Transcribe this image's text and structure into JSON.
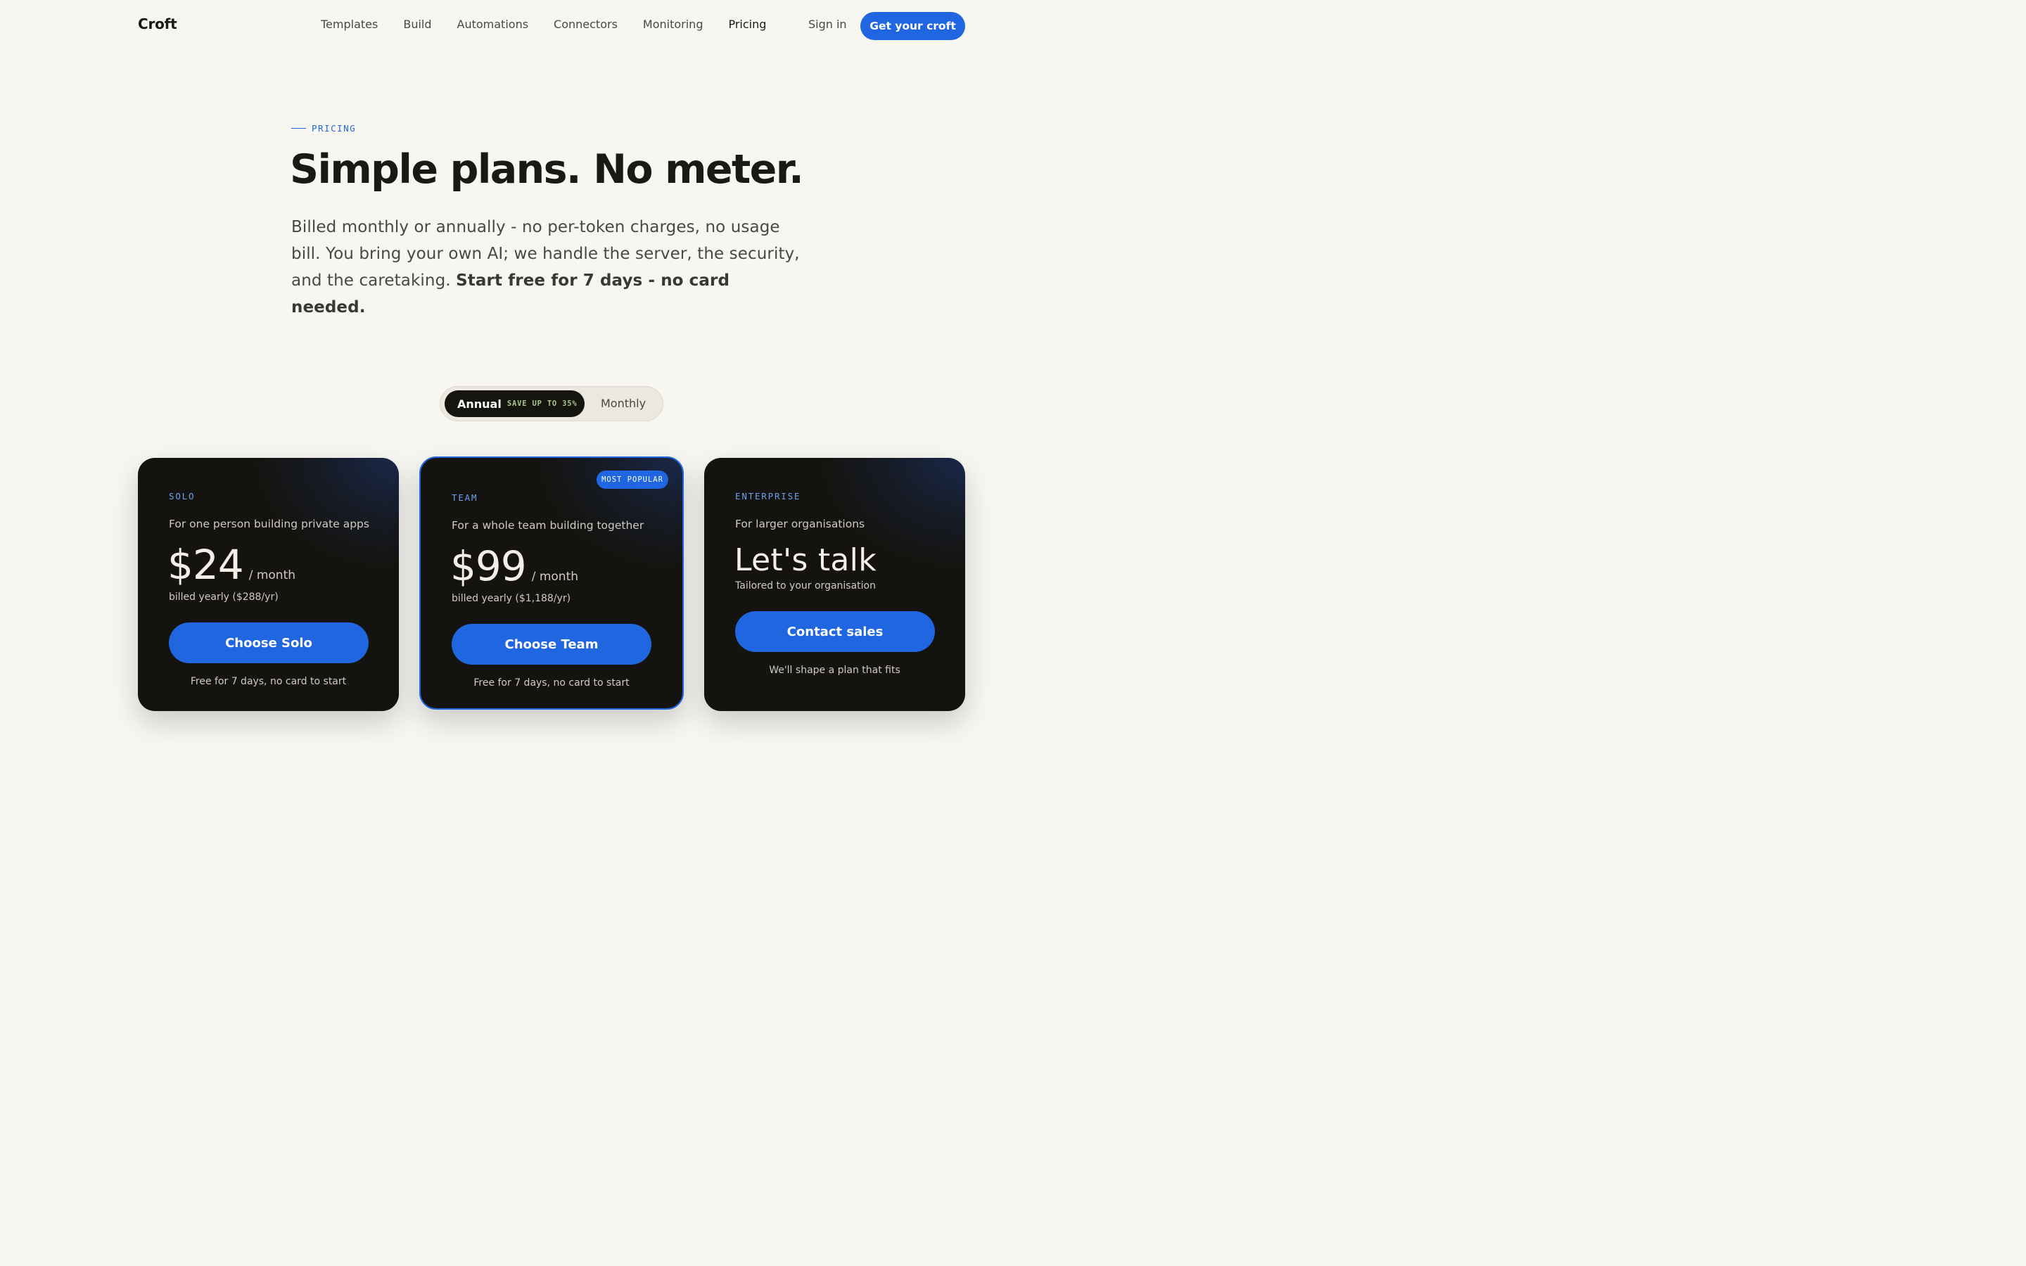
{
  "nav": {
    "logo": "Croft",
    "links": [
      "Templates",
      "Build",
      "Automations",
      "Connectors",
      "Monitoring",
      "Pricing"
    ],
    "active": "Pricing",
    "signin": "Sign in",
    "cta": "Get your croft"
  },
  "hero": {
    "eyebrow": "PRICING",
    "headline": "Simple plans. No meter.",
    "lede": "Billed monthly or annually - no per-token charges, no usage bill. You bring your own AI; we handle the server, the security, and the caretaking.",
    "lede_strong": "Start free for 7 days - no card needed."
  },
  "toggle": {
    "annual": "Annual",
    "save": "SAVE UP TO 35%",
    "monthly": "Monthly",
    "selected": "Annual"
  },
  "plans": [
    {
      "tier": "SOLO",
      "desc": "For one person building private apps",
      "price": "$24",
      "per": "/ month",
      "billed": "billed yearly ($288/yr)",
      "button": "Choose Solo",
      "note": "Free for 7 days, no card to start"
    },
    {
      "tier": "TEAM",
      "badge": "MOST POPULAR",
      "desc": "For a whole team building together",
      "price": "$99",
      "per": "/ month",
      "billed": "billed yearly ($1,188/yr)",
      "button": "Choose Team",
      "note": "Free for 7 days, no card to start"
    },
    {
      "tier": "ENTERPRISE",
      "desc": "For larger organisations",
      "price": "Let's talk",
      "subline": "Tailored to your organisation",
      "button": "Contact sales",
      "note": "We'll shape a plan that fits"
    }
  ],
  "colors": {
    "accent": "#1f66e0",
    "background": "#f7f6f1",
    "card": "#14130f"
  }
}
